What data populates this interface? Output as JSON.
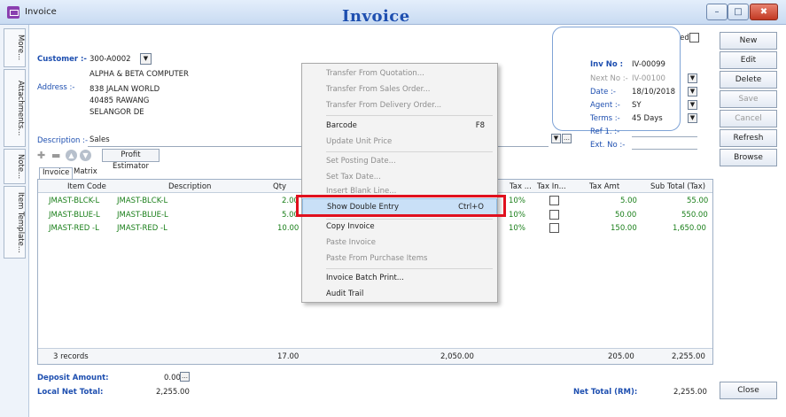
{
  "window": {
    "title": "Invoice",
    "minimize": "–",
    "restore": "□",
    "close": "✖"
  },
  "side_tabs": [
    "More...",
    "Attachments...",
    "Note...",
    "Item Template..."
  ],
  "heading": "Invoice",
  "cancelled_label": "Cancelled",
  "customer": {
    "label": "Customer :-",
    "code": "300-A0002",
    "name": "ALPHA & BETA COMPUTER"
  },
  "address": {
    "label": "Address :-",
    "lines": [
      "838 JALAN WORLD",
      "40485 RAWANG",
      "SELANGOR DE"
    ]
  },
  "description": {
    "label": "Description :-",
    "value": "Sales"
  },
  "toolbar": {
    "profit_estimator": "Profit Estimator"
  },
  "tabs": [
    "Invoice",
    "Matrix"
  ],
  "info": {
    "inv_no_label": "Inv No :",
    "inv_no": "IV-00099",
    "next_no_label": "Next No :-",
    "next_no": "IV-00100",
    "date_label": "Date :-",
    "date": "18/10/2018",
    "agent_label": "Agent :-",
    "agent": "SY",
    "terms_label": "Terms :-",
    "terms": "45 Days",
    "ref1_label": "Ref 1. :-",
    "extno_label": "Ext. No :-"
  },
  "right_buttons": [
    "New",
    "Edit",
    "Delete",
    "Save",
    "Cancel",
    "Refresh",
    "Browse"
  ],
  "close_button": "Close",
  "grid": {
    "headers": [
      "Item Code",
      "Description",
      "Qty",
      "Tax ...",
      "Tax In...",
      "Tax Amt",
      "Sub Total (Tax)"
    ],
    "rows": [
      {
        "code": "JMAST-BLCK-L",
        "desc": "JMAST-BLCK-L",
        "qty": "2.00",
        "tax": "10%",
        "tax_amt": "5.00",
        "subtotal": "55.00"
      },
      {
        "code": "JMAST-BLUE-L",
        "desc": "JMAST-BLUE-L",
        "qty": "5.00",
        "tax": "10%",
        "tax_amt": "50.00",
        "subtotal": "550.00"
      },
      {
        "code": "JMAST-RED -L",
        "desc": "JMAST-RED -L",
        "qty": "10.00",
        "tax": "10%",
        "tax_amt": "150.00",
        "subtotal": "1,650.00"
      }
    ],
    "footer": {
      "records": "3 records",
      "qty_total": "17.00",
      "amount_total": "2,050.00",
      "tax_total": "205.00",
      "subtotal_total": "2,255.00"
    }
  },
  "totals": {
    "deposit_label": "Deposit Amount:",
    "deposit": "0.00",
    "local_net_label": "Local Net Total:",
    "local_net": "2,255.00",
    "net_total_label": "Net Total (RM):",
    "net_total": "2,255.00"
  },
  "context_menu": {
    "items": [
      {
        "label": "Transfer From Quotation...",
        "shortcut": "",
        "enabled": false
      },
      {
        "label": "Transfer From Sales Order...",
        "shortcut": "",
        "enabled": false
      },
      {
        "label": "Transfer From Delivery Order...",
        "shortcut": "",
        "enabled": false
      },
      {
        "label": "Barcode",
        "shortcut": "F8",
        "enabled": true
      },
      {
        "label": "Update Unit Price",
        "shortcut": "",
        "enabled": false
      },
      {
        "label": "Set Posting Date...",
        "shortcut": "",
        "enabled": false
      },
      {
        "label": "Set Tax Date...",
        "shortcut": "",
        "enabled": false
      },
      {
        "label": "Insert Blank Line...",
        "shortcut": "",
        "enabled": false
      },
      {
        "label": "Show Double Entry",
        "shortcut": "Ctrl+O",
        "enabled": true
      },
      {
        "label": "Copy Invoice",
        "shortcut": "",
        "enabled": true
      },
      {
        "label": "Paste Invoice",
        "shortcut": "",
        "enabled": false
      },
      {
        "label": "Paste From Purchase Items",
        "shortcut": "",
        "enabled": false
      },
      {
        "label": "Invoice Batch Print...",
        "shortcut": "",
        "enabled": true
      },
      {
        "label": "Audit Trail",
        "shortcut": "",
        "enabled": true
      }
    ]
  },
  "colors": {
    "accent": "#1e4fb0",
    "highlight_box": "#e0101e",
    "row_text": "#1a7f1a"
  }
}
